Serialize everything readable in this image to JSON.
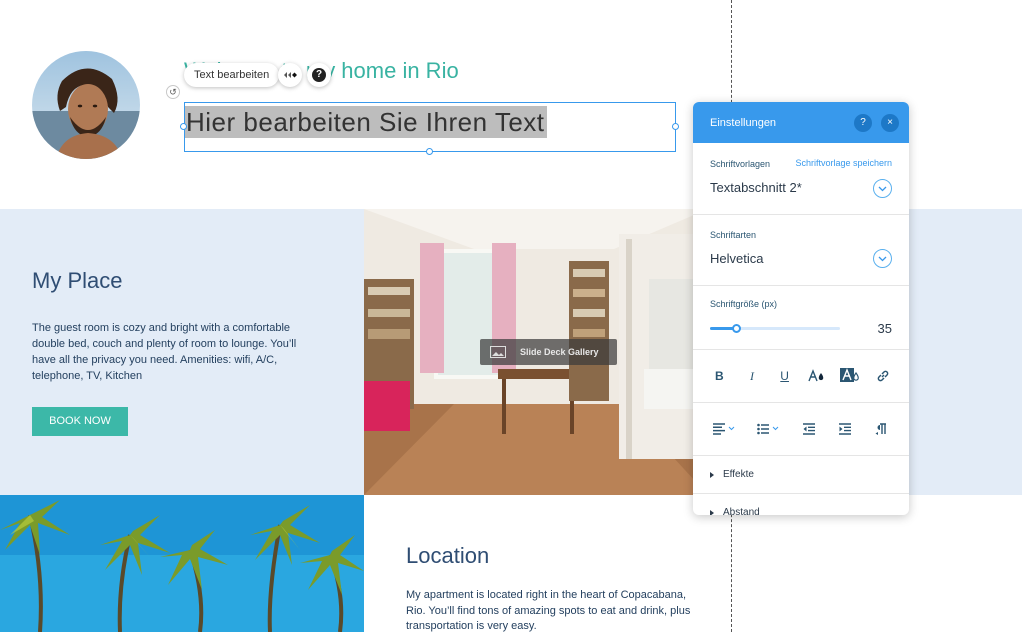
{
  "header": {
    "heading_partial": "y home in Rio",
    "heading_hidden": "Welcome to m",
    "selected_text": "Hier bearbeiten Sie Ihren Text"
  },
  "toolbar": {
    "edit_text_label": "Text bearbeiten",
    "animation_icon": "animation-icon",
    "help_icon": "help-icon",
    "help_glyph": "?"
  },
  "place": {
    "title": "My Place",
    "description": "The guest room is cozy and bright with a comfortable double bed, couch and plenty of room to lounge. You’ll have all the privacy you need. Amenities: wifi, A/C, telephone, TV, Kitchen",
    "book_label": "BOOK NOW"
  },
  "gallery": {
    "label": "Slide Deck Gallery"
  },
  "location": {
    "title": "Location",
    "description": "My apartment is located right in the heart of Copacabana, Rio. You’ll find tons of amazing spots to eat and drink, plus transportation is very easy."
  },
  "settings": {
    "title": "Einstellungen",
    "help_glyph": "?",
    "close_glyph": "×",
    "style_label": "Schriftvorlagen",
    "save_style_link": "Schriftvorlage speichern",
    "style_value": "Textabschnitt 2*",
    "font_label": "Schriftarten",
    "font_value": "Helvetica",
    "size_label": "Schriftgröße (px)",
    "size_value": "35",
    "size_fraction": 0.2,
    "format_buttons": [
      "B",
      "I",
      "U"
    ],
    "effects_label": "Effekte",
    "spacing_label": "Abstand"
  },
  "colors": {
    "accent_blue": "#3899ec",
    "teal": "#39b3a2",
    "section_blue": "#e3ecf7"
  }
}
